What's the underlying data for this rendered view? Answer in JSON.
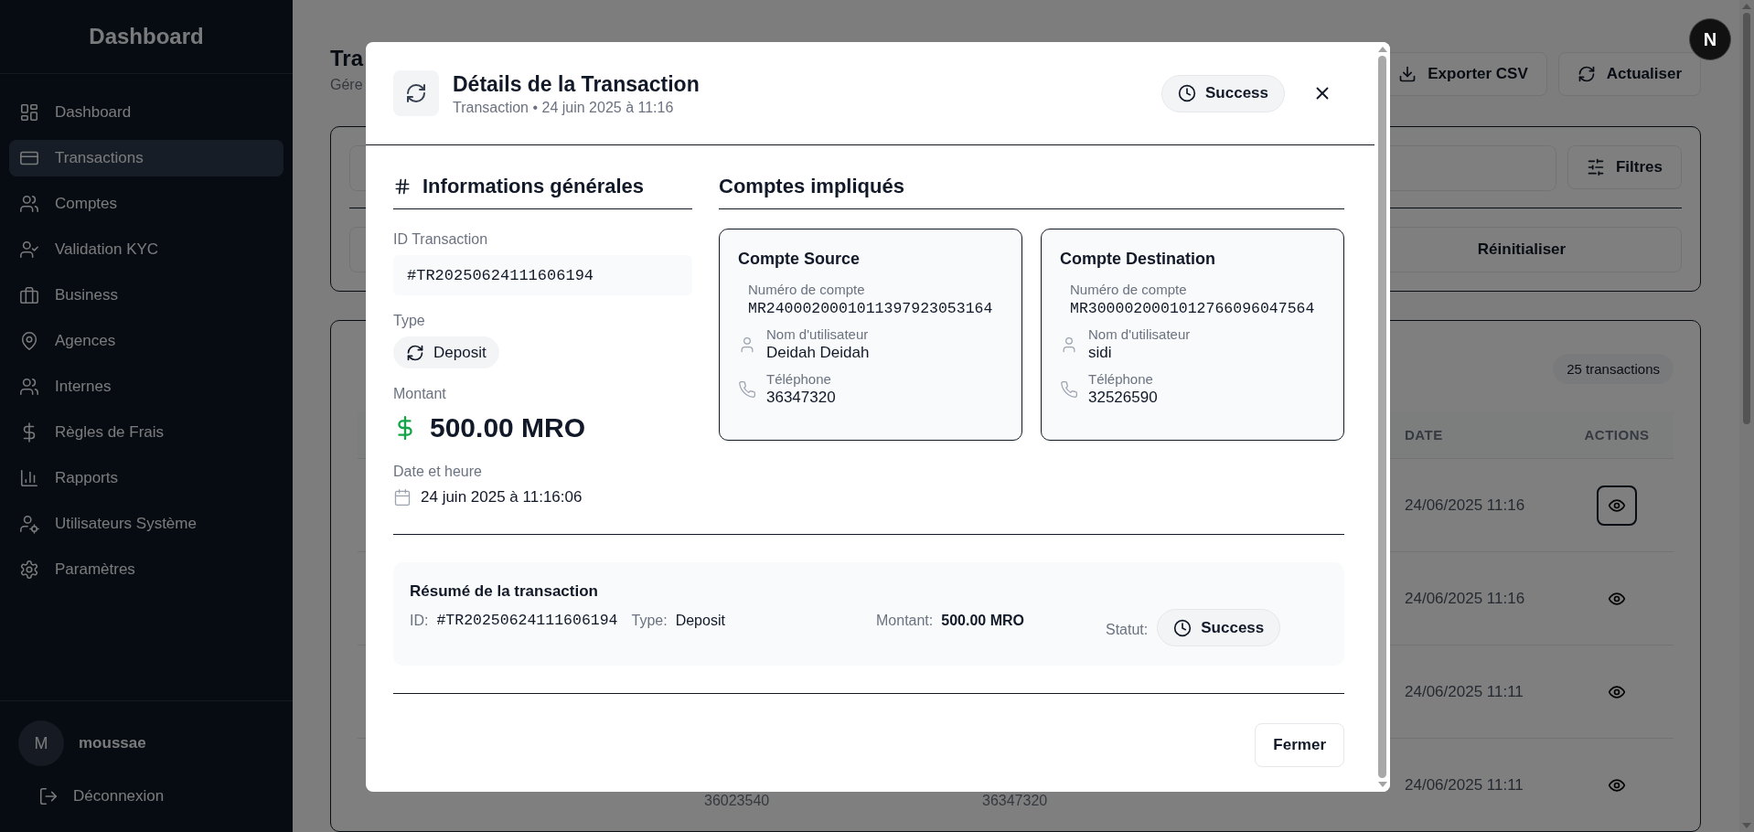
{
  "sidebar": {
    "title": "Dashboard",
    "items": [
      {
        "label": "Dashboard",
        "selected": false
      },
      {
        "label": "Transactions",
        "selected": true
      },
      {
        "label": "Comptes",
        "selected": false
      },
      {
        "label": "Validation KYC",
        "selected": false
      },
      {
        "label": "Business",
        "selected": false
      },
      {
        "label": "Agences",
        "selected": false
      },
      {
        "label": "Internes",
        "selected": false
      },
      {
        "label": "Règles de Frais",
        "selected": false
      },
      {
        "label": "Rapports",
        "selected": false
      },
      {
        "label": "Utilisateurs Système",
        "selected": false
      },
      {
        "label": "Paramètres",
        "selected": false
      }
    ],
    "user": {
      "initial": "M",
      "name": "moussae"
    },
    "logout": "Déconnexion"
  },
  "page": {
    "title": "Tra",
    "subtitle": "Gére",
    "actions": [
      "Exporter CSV",
      "Actualiser"
    ],
    "dev_badge": "N"
  },
  "filters": {
    "filter_button": "Filtres",
    "reset_button": "Réinitialiser"
  },
  "list": {
    "count": "25 transactions",
    "columns": [
      "DATE",
      "ACTIONS"
    ],
    "rows": [
      {
        "date": "24/06/2025 11:16",
        "focused": true
      },
      {
        "date": "24/06/2025 11:16",
        "focused": false
      },
      {
        "date": "24/06/2025 11:11",
        "focused": false
      },
      {
        "source_phone": "36023540",
        "destination_phone": "36347320",
        "date": "24/06/2025 11:11",
        "focused": false
      }
    ]
  },
  "modal": {
    "title": "Détails de la Transaction",
    "subtitle": "Transaction • 24 juin 2025 à 11:16",
    "status": "Success",
    "general": {
      "heading": "Informations générales",
      "id_label": "ID Transaction",
      "id": "#TR20250624111606194",
      "type_label": "Type",
      "type": "Deposit",
      "amount_label": "Montant",
      "amount": "500.00 MRO",
      "date_label": "Date et heure",
      "date": "24 juin 2025 à 11:16:06"
    },
    "accounts": {
      "heading": "Comptes impliqués",
      "cards": [
        {
          "title": "Compte Source",
          "number_label": "Numéro de compte",
          "number": "MR2400020001011397923053164",
          "name_label": "Nom d'utilisateur",
          "name": "Deidah Deidah",
          "phone_label": "Téléphone",
          "phone": "36347320"
        },
        {
          "title": "Compte Destination",
          "number_label": "Numéro de compte",
          "number": "MR3000020001012766096047564",
          "name_label": "Nom d'utilisateur",
          "name": "sidi",
          "phone_label": "Téléphone",
          "phone": "32526590"
        }
      ]
    },
    "summary": {
      "title": "Résumé de la transaction",
      "id_label": "ID:",
      "id": "#TR20250624111606194",
      "type_label": "Type:",
      "type": "Deposit",
      "amount_label": "Montant:",
      "amount": "500.00 MRO",
      "status_label": "Statut:",
      "status": "Success"
    },
    "close_button": "Fermer"
  }
}
